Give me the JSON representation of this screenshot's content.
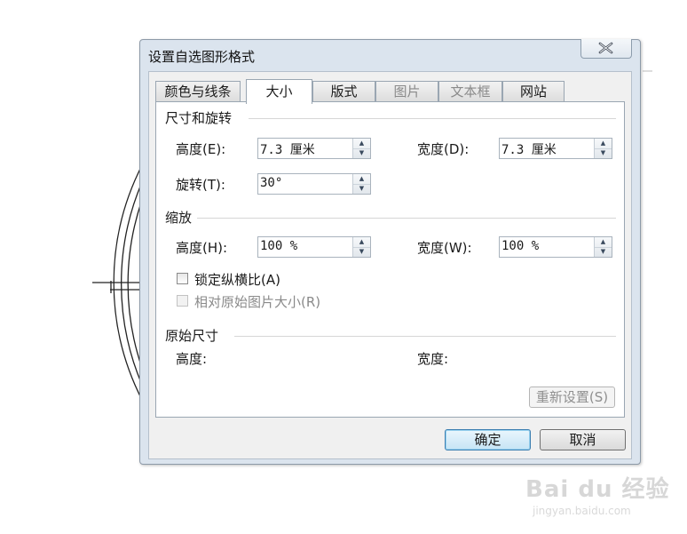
{
  "dialog": {
    "title": "设置自选图形格式",
    "tabs": [
      {
        "label": "颜色与线条",
        "state": "normal"
      },
      {
        "label": "大小",
        "state": "active"
      },
      {
        "label": "版式",
        "state": "normal"
      },
      {
        "label": "图片",
        "state": "disabled"
      },
      {
        "label": "文本框",
        "state": "disabled"
      },
      {
        "label": "网站",
        "state": "normal"
      }
    ],
    "size_rotate": {
      "title": "尺寸和旋转",
      "height_label": "高度(E):",
      "height_value": "7.3 厘米",
      "width_label": "宽度(D):",
      "width_value": "7.3 厘米",
      "rotation_label": "旋转(T):",
      "rotation_value": "30°"
    },
    "scale": {
      "title": "缩放",
      "height_label": "高度(H):",
      "height_value": "100 %",
      "width_label": "宽度(W):",
      "width_value": "100 %",
      "lock_aspect_label": "锁定纵横比(A)",
      "lock_aspect_checked": false,
      "relative_label": "相对原始图片大小(R)",
      "relative_checked": false
    },
    "original_size": {
      "title": "原始尺寸",
      "height_label": "高度:",
      "width_label": "宽度:",
      "reset_label": "重新设置(S)"
    },
    "buttons": {
      "ok": "确定",
      "cancel": "取消"
    }
  },
  "watermark": {
    "brand": "Bai du 经验",
    "url": "jingyan.baidu.com"
  }
}
